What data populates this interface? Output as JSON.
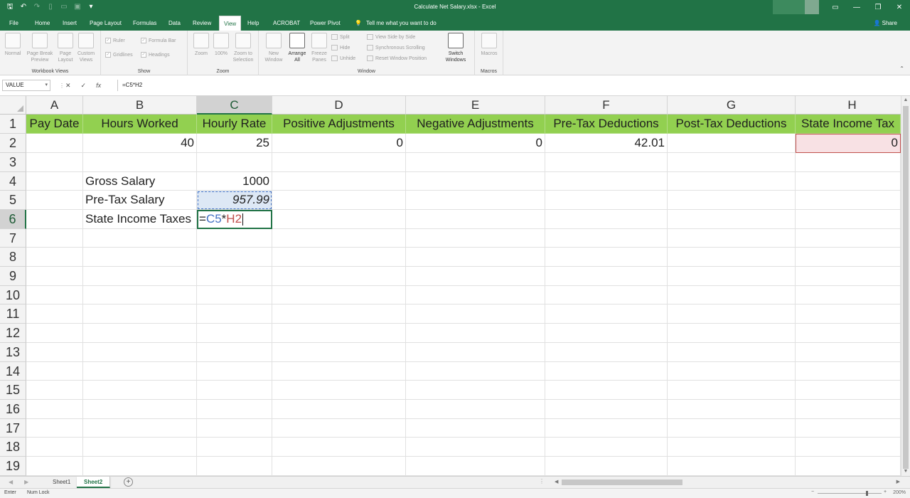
{
  "titlebar": {
    "title": "Calculate Net Salary.xlsx - Excel",
    "minimize": "—",
    "restore": "❐",
    "close": "✕"
  },
  "menu": {
    "tabs": [
      "File",
      "Home",
      "Insert",
      "Page Layout",
      "Formulas",
      "Data",
      "Review",
      "View",
      "Help",
      "ACROBAT",
      "Power Pivot"
    ],
    "active_tab": "View",
    "tell_me": "Tell me what you want to do",
    "share": "Share"
  },
  "ribbon": {
    "workbook_views": {
      "label": "Workbook Views",
      "normal": "Normal",
      "page_break": "Page Break Preview",
      "page_layout": "Page Layout",
      "custom_views": "Custom Views"
    },
    "show": {
      "label": "Show",
      "ruler": "Ruler",
      "formula_bar": "Formula Bar",
      "gridlines": "Gridlines",
      "headings": "Headings"
    },
    "zoom": {
      "label": "Zoom",
      "zoom": "Zoom",
      "hundred": "100%",
      "zoom_selection": "Zoom to Selection"
    },
    "window": {
      "label": "Window",
      "new_window": "New Window",
      "arrange_all": "Arrange All",
      "freeze_panes": "Freeze Panes",
      "split": "Split",
      "hide": "Hide",
      "unhide": "Unhide",
      "side_by_side": "View Side by Side",
      "sync_scroll": "Synchronous Scrolling",
      "reset_pos": "Reset Window Position",
      "switch_windows": "Switch Windows"
    },
    "macros": {
      "label": "Macros",
      "macros": "Macros"
    }
  },
  "formula_bar": {
    "name_box": "VALUE",
    "formula": "=C5*H2",
    "cancel": "✕",
    "enter": "✓",
    "fx": "fx"
  },
  "columns": [
    "A",
    "B",
    "C",
    "D",
    "E",
    "F",
    "G",
    "H"
  ],
  "rows": [
    "1",
    "2",
    "3",
    "4",
    "5",
    "6",
    "7",
    "8",
    "9",
    "10",
    "11",
    "12",
    "13",
    "14",
    "15",
    "16",
    "17",
    "18",
    "19"
  ],
  "cells": {
    "A1": "Pay Date",
    "B1": "Hours Worked",
    "C1": "Hourly Rate",
    "D1": "Positive Adjustments",
    "E1": "Negative Adjustments",
    "F1": "Pre-Tax Deductions",
    "G1": "Post-Tax Deductions",
    "H1": "State Income Tax",
    "B2": "40",
    "C2": "25",
    "D2": "0",
    "E2": "0",
    "F2": "42.01",
    "H2": "0",
    "B4": "Gross Salary",
    "C4": "1000",
    "B5": "Pre-Tax Salary",
    "C5": "957.99",
    "B6": "State Income Taxes",
    "C6_eq": "=",
    "C6_ref1": "C5",
    "C6_op": "*",
    "C6_ref2": "H2"
  },
  "sheets": [
    "Sheet1",
    "Sheet2"
  ],
  "active_sheet": "Sheet2",
  "status": {
    "mode": "Enter",
    "num_lock": "Num Lock",
    "zoom": "200%"
  },
  "colors": {
    "accent": "#217346",
    "header_fill": "#92d050",
    "ref1": "#4472c4",
    "ref2": "#c0504d"
  }
}
